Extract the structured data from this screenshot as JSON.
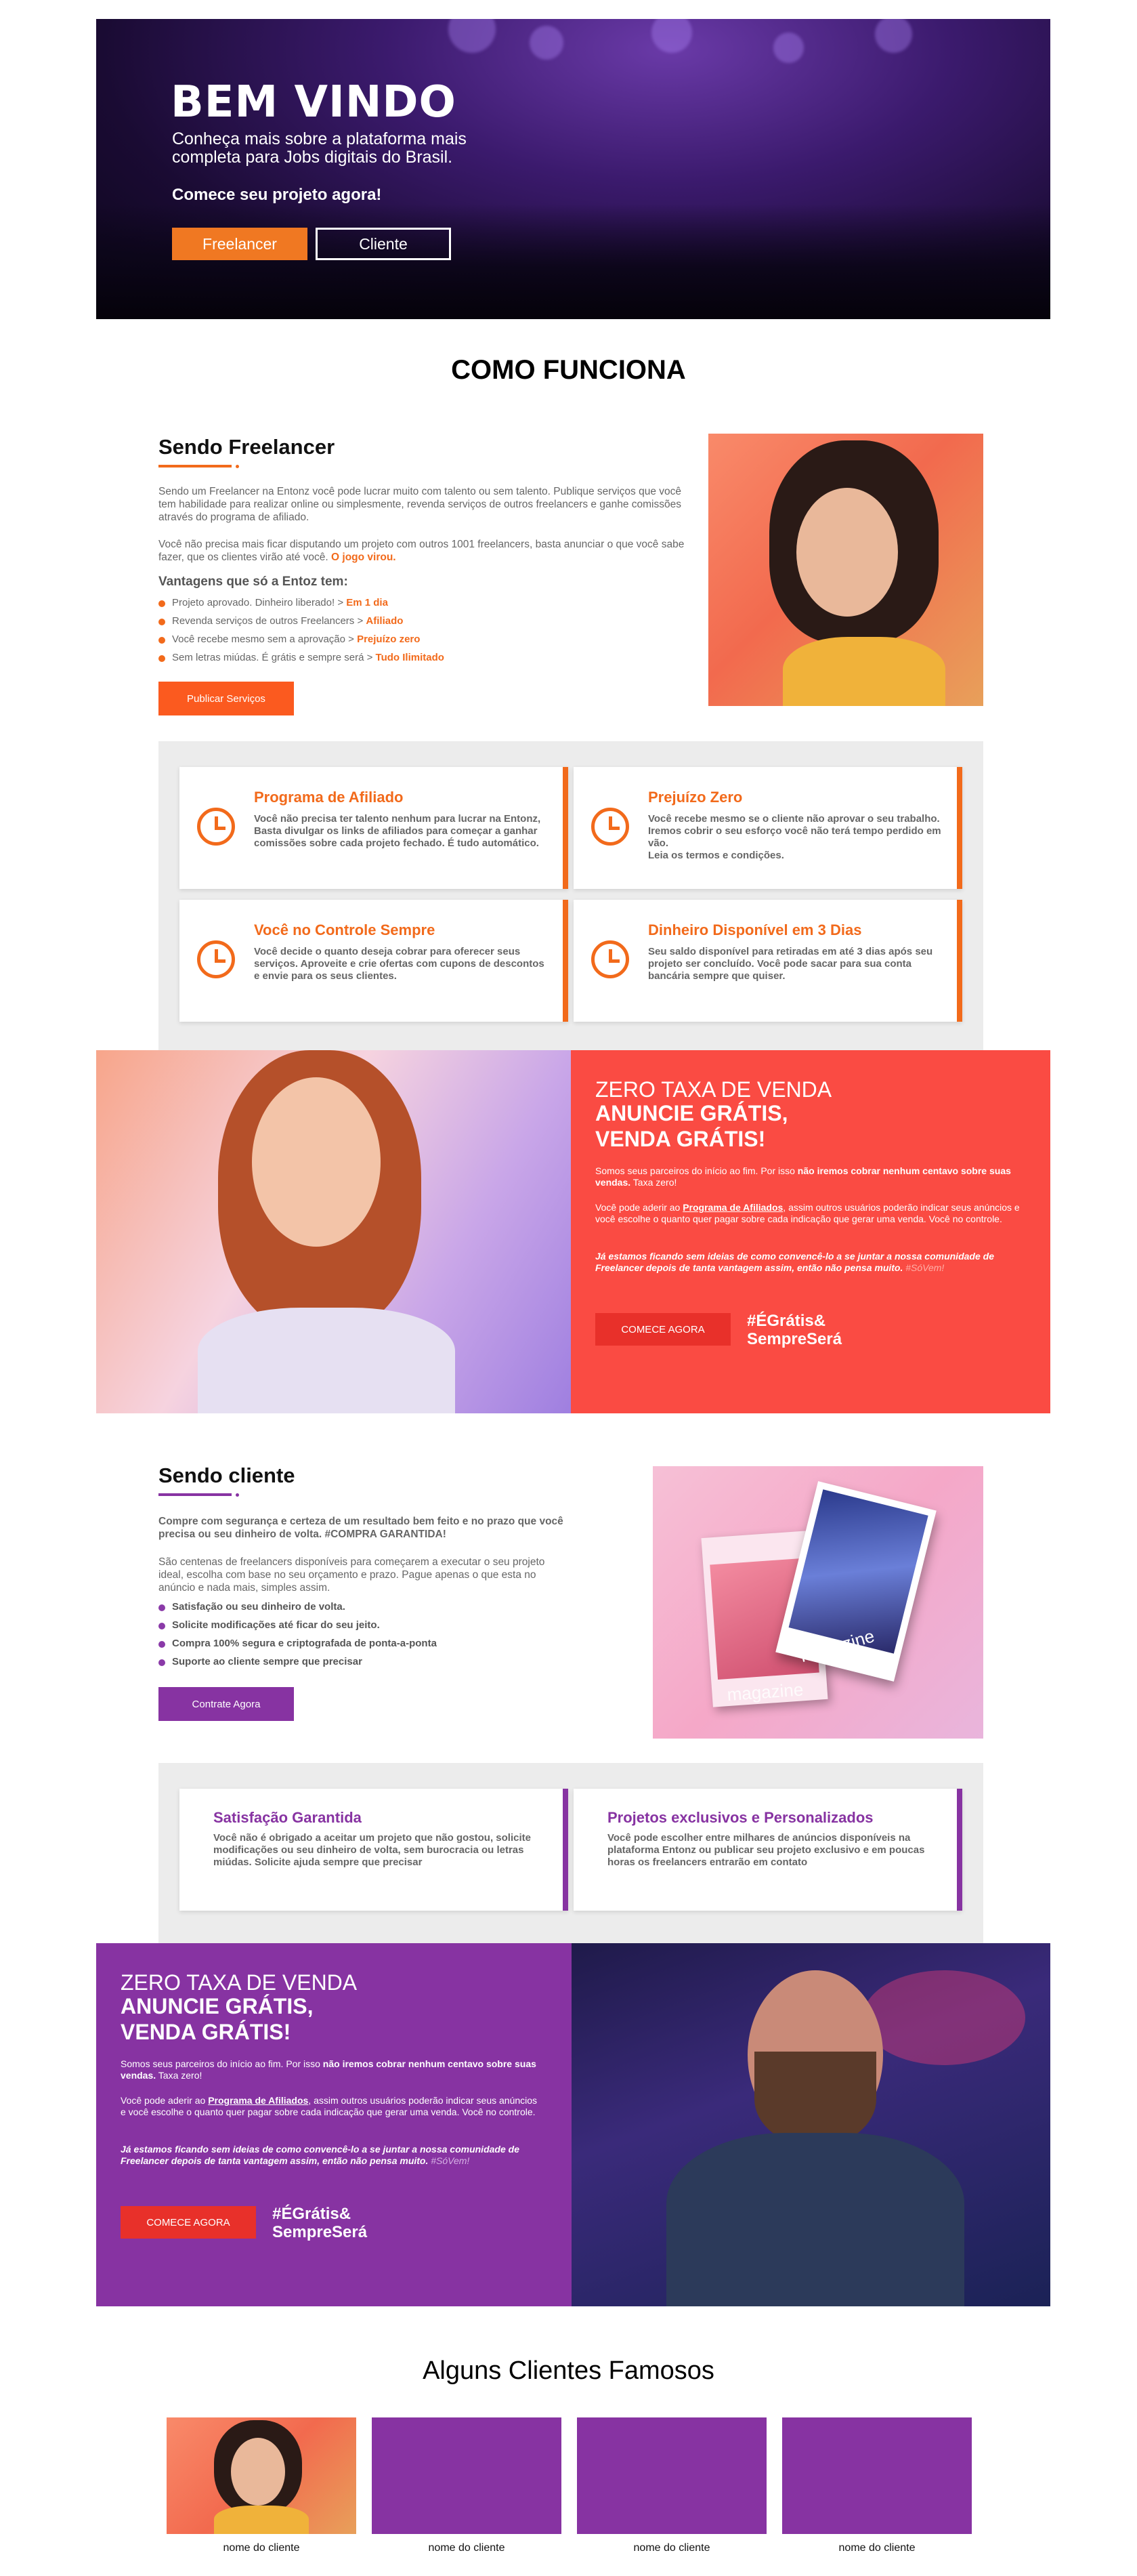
{
  "hero": {
    "title": "BEM VINDO",
    "subtitle": "Conheça mais sobre a plataforma mais completa para Jobs digitais do Brasil.",
    "cta_text": "Comece seu projeto agora!",
    "btn_freelancer": "Freelancer",
    "btn_cliente": "Cliente"
  },
  "como_funciona": {
    "title": "COMO FUNCIONA"
  },
  "freelancer": {
    "title": "Sendo Freelancer",
    "para1": "Sendo um Freelancer na Entonz você pode lucrar muito com talento ou sem talento. Publique serviços que você tem habilidade para realizar online ou simplesmente, revenda serviços de outros freelancers e ganhe comissões através do programa de afiliado.",
    "para2_a": "Você não precisa mais ficar disputando um projeto com outros 1001 freelancers, basta anunciar o que você sabe fazer, que os clientes virão até você. ",
    "para2_b": "O jogo virou.",
    "advantages_title": "Vantagens que só a Entoz tem:",
    "advantages": [
      {
        "text": "Projeto aprovado. Dinheiro liberado! > ",
        "hl": "Em 1 dia"
      },
      {
        "text": "Revenda serviços de outros Freelancers > ",
        "hl": "Afiliado"
      },
      {
        "text": "Você recebe mesmo sem a aprovação > ",
        "hl": "Prejuízo zero"
      },
      {
        "text": "Sem letras miúdas. É grátis e sempre será > ",
        "hl": "Tudo Ilimitado"
      }
    ],
    "button": "Publicar Serviços"
  },
  "freelancer_cards": [
    {
      "title": "Programa de Afiliado",
      "text": "Você não precisa ter talento nenhum para lucrar na Entonz, Basta divulgar os links de afiliados para começar a ganhar comissões sobre cada projeto fechado. É tudo automático."
    },
    {
      "title": "Prejuízo Zero",
      "text": "Você recebe mesmo se o cliente não aprovar o seu trabalho. Iremos cobrir o seu esforço você não terá tempo perdido em vão.",
      "link": "Leia os termos e condições."
    },
    {
      "title": "Você no Controle Sempre",
      "text": "Você decide o quanto deseja cobrar para oferecer seus serviços. Aproveite e crie ofertas com cupons de descontos e envie para os seus clientes."
    },
    {
      "title": "Dinheiro Disponível em 3 Dias",
      "text": "Seu saldo disponível para retiradas em até 3 dias após seu projeto ser concluído. Você pode sacar para sua conta bancária sempre que quiser."
    }
  ],
  "promo1": {
    "line1": "ZERO TAXA DE VENDA",
    "line2": "ANUNCIE GRÁTIS,",
    "line3": "VENDA GRÁTIS!",
    "p1_a": "Somos seus parceiros do início ao fim. Por isso ",
    "p1_b": "não iremos cobrar nenhum centavo sobre suas vendas.",
    "p1_c": " Taxa zero!",
    "p2_a": "Você pode aderir ao ",
    "p2_b": "Programa de Afiliados",
    "p2_c": ", assim outros usuários poderão indicar seus anúncios e você escolhe o quanto quer pagar sobre cada indicação que gerar uma venda. Você no controle.",
    "p3_a": "Já estamos ficando sem ideias de como convencê-lo a se juntar a nossa comunidade de Freelancer depois de tanta vantagem assim, então não pensa muito. ",
    "p3_b": "#SóVem!",
    "button": "COMECE AGORA",
    "tag1": "#ÉGrátis&",
    "tag2": "SempreSerá"
  },
  "cliente": {
    "title": "Sendo cliente",
    "para1": "Compre com segurança e certeza de um resultado bem feito e no prazo que você precisa ou seu dinheiro de volta. #COMPRA GARANTIDA!",
    "para2": "São centenas de freelancers disponíveis para começarem a executar o seu projeto ideal, escolha com base no seu orçamento e prazo. Pague apenas o que esta no anúncio e nada mais, simples assim.",
    "bullets": [
      "Satisfação ou seu dinheiro de volta.",
      "Solicite modificações até ficar do seu jeito.",
      "Compra 100% segura e criptografada de ponta-a-ponta",
      "Suporte ao cliente sempre que precisar"
    ],
    "button": "Contrate Agora",
    "magazine1": "magazine",
    "magazine2": "magazine"
  },
  "cliente_cards": [
    {
      "title": "Satisfação Garantida",
      "text": "Você não é obrigado a aceitar um projeto que não gostou, solicite modificações ou seu dinheiro de volta, sem burocracia ou letras miúdas. Solicite ajuda sempre que precisar"
    },
    {
      "title": "Projetos exclusivos e Personalizados",
      "text": "Você pode escolher entre milhares de anúncios disponíveis na plataforma Entonz ou publicar seu projeto exclusivo e em poucas horas os freelancers entrarão em contato"
    }
  ],
  "promo2": {
    "line1": "ZERO TAXA DE VENDA",
    "line2": "ANUNCIE GRÁTIS,",
    "line3": "VENDA GRÁTIS!",
    "p1_a": "Somos seus parceiros do início ao fim. Por isso ",
    "p1_b": "não iremos cobrar nenhum centavo sobre suas vendas.",
    "p1_c": " Taxa zero!",
    "p2_a": "Você pode aderir ao ",
    "p2_b": "Programa de Afiliados",
    "p2_c": ", assim outros usuários poderão indicar seus anúncios e você escolhe o quanto quer pagar sobre cada indicação que gerar uma venda. Você no controle.",
    "p3_a": "Já estamos ficando sem ideias de como convencê-lo a se juntar a nossa comunidade de Freelancer depois de tanta vantagem assim, então não pensa muito. ",
    "p3_b": "#SóVem!",
    "button": "COMECE AGORA",
    "tag1": "#ÉGrátis&",
    "tag2": "SempreSerá"
  },
  "clientes_famosos": {
    "title": "Alguns Clientes Famosos",
    "items": [
      {
        "name": "nome do cliente"
      },
      {
        "name": "nome do cliente"
      },
      {
        "name": "nome do cliente"
      },
      {
        "name": "nome do cliente"
      }
    ]
  },
  "colors": {
    "orange": "#f26a1b",
    "purple": "#8733a2",
    "coral": "#fa4b43",
    "red_button": "#e8302a"
  }
}
